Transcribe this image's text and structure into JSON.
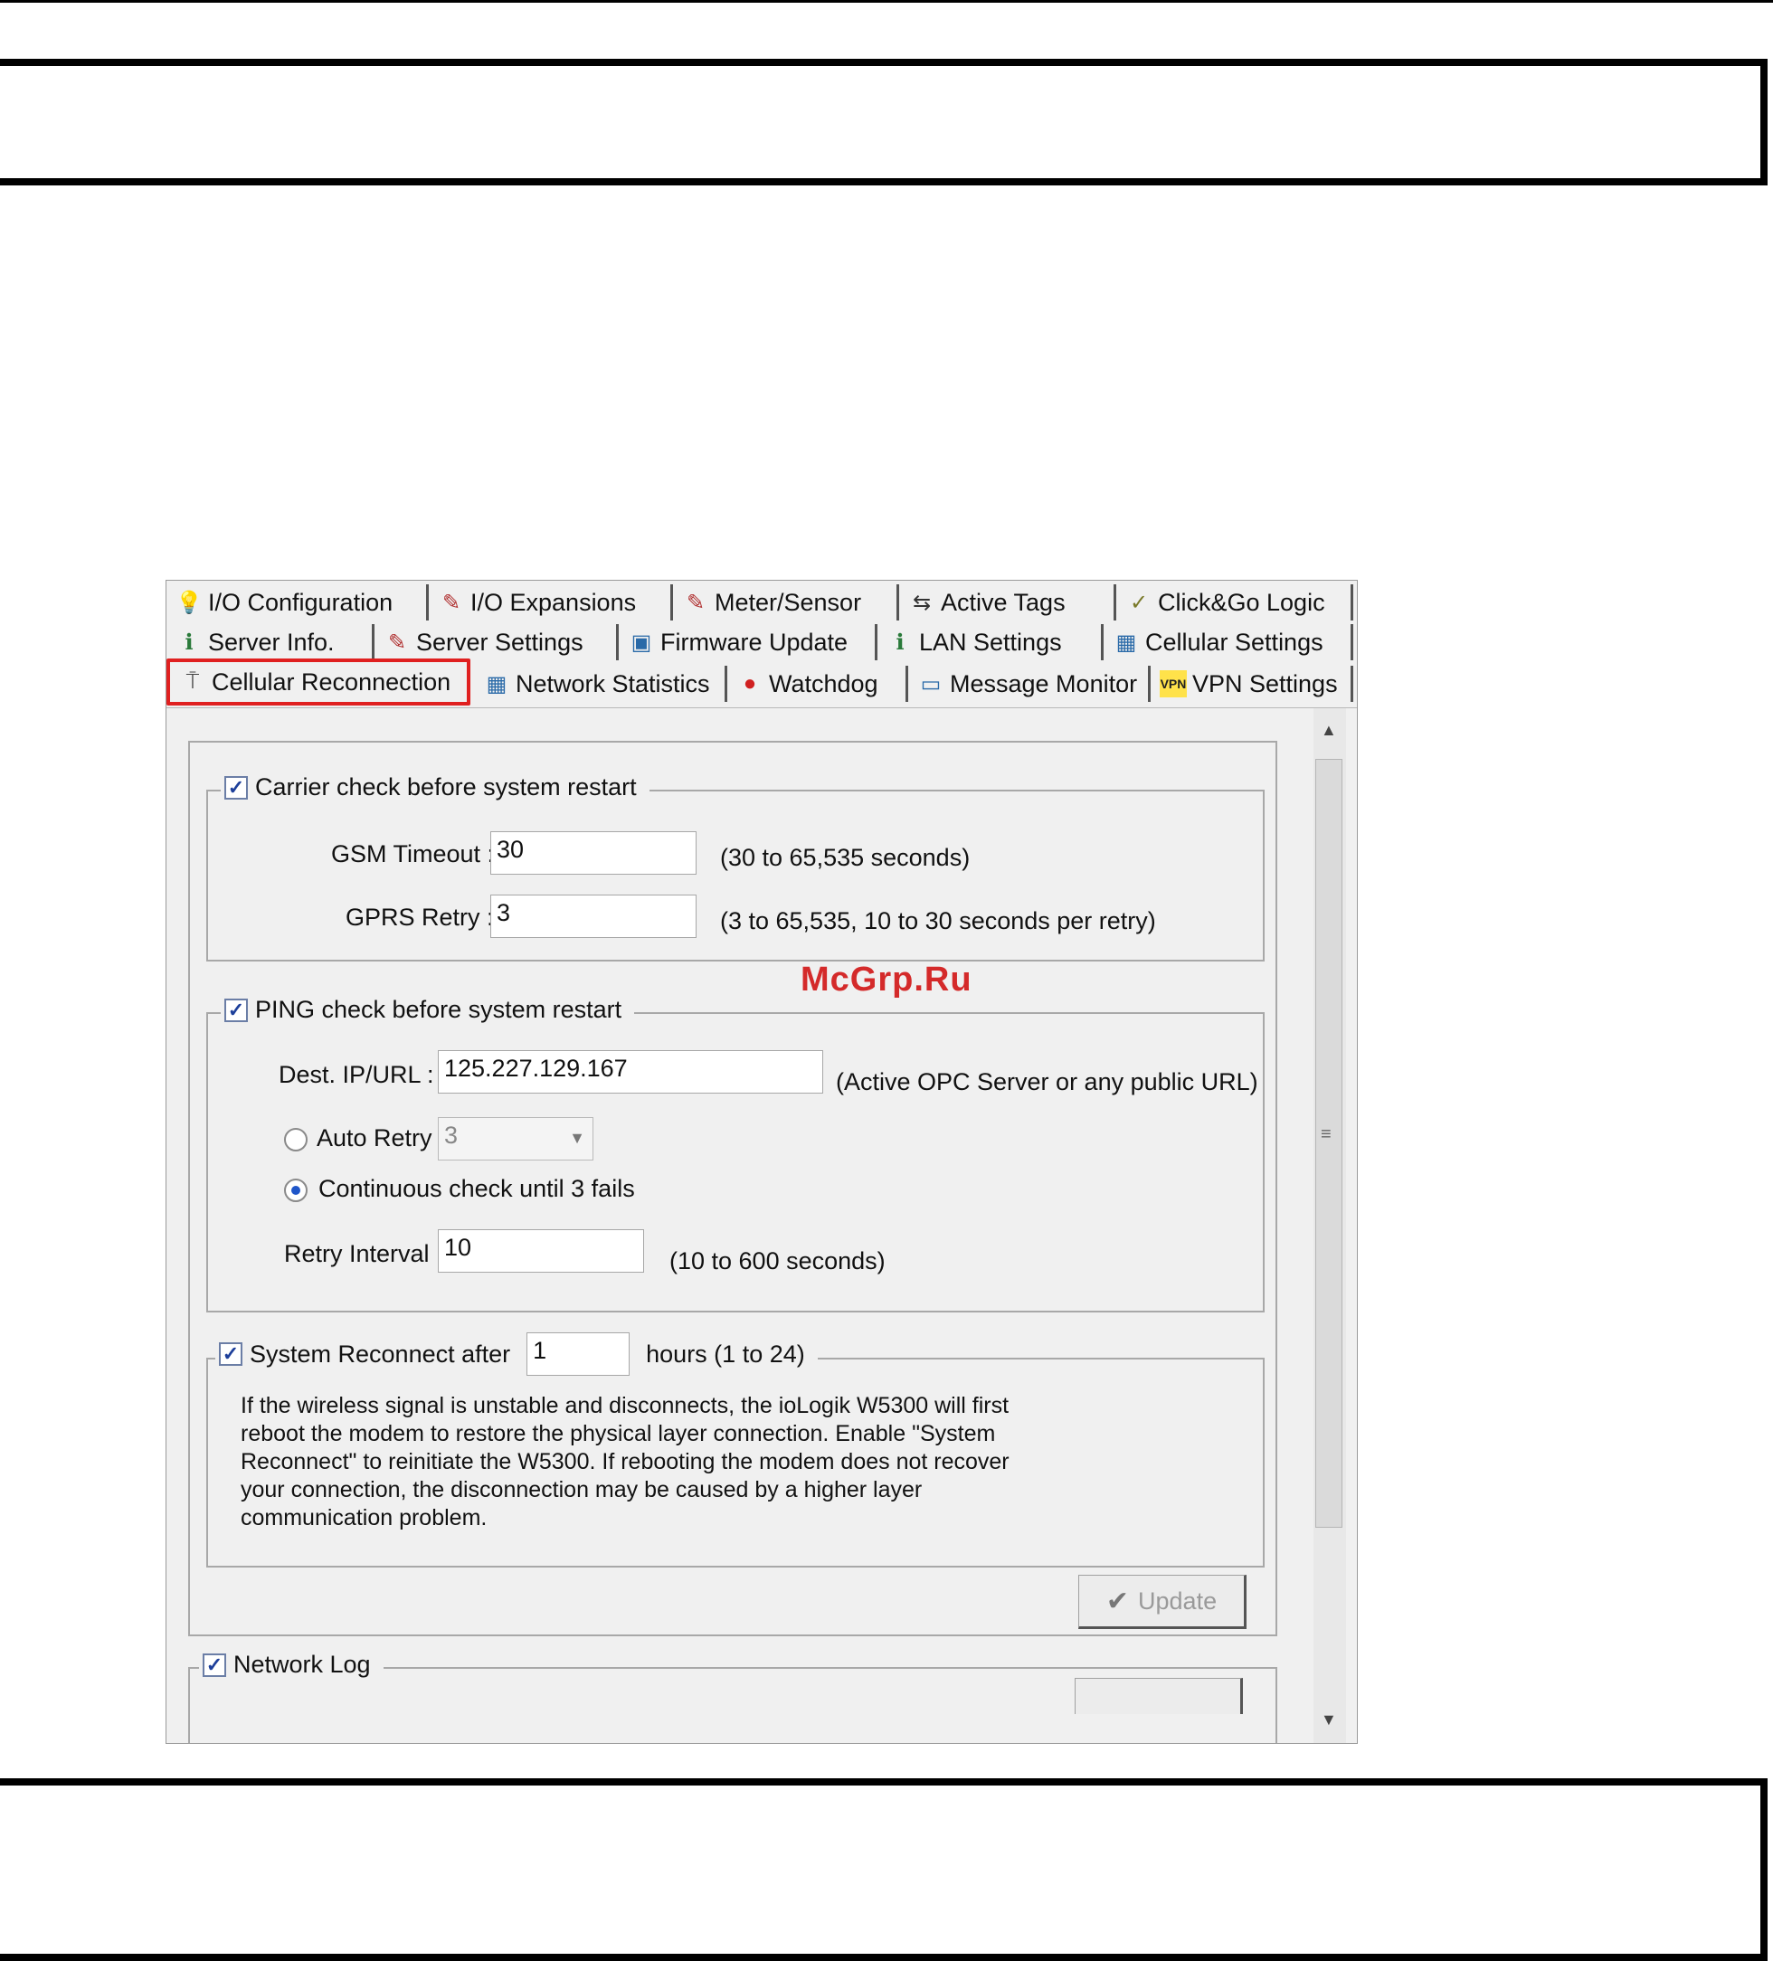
{
  "tabs": {
    "row1": [
      "I/O Configuration",
      "I/O Expansions",
      "Meter/Sensor",
      "Active Tags",
      "Click&Go Logic"
    ],
    "row2": [
      "Server Info.",
      "Server Settings",
      "Firmware Update",
      "LAN Settings",
      "Cellular Settings"
    ],
    "row3": [
      "Cellular Reconnection",
      "Network Statistics",
      "Watchdog",
      "Message Monitor",
      "VPN Settings"
    ],
    "active": "Cellular Reconnection"
  },
  "carrier": {
    "label": "Carrier check before system restart",
    "checked": true,
    "gsm_label": "GSM Timeout :",
    "gsm_value": "30",
    "gsm_hint": "(30 to 65,535 seconds)",
    "gprs_label": "GPRS Retry :",
    "gprs_value": "3",
    "gprs_hint": "(3 to 65,535, 10 to 30 seconds per retry)"
  },
  "ping": {
    "label": "PING check before system restart",
    "checked": true,
    "dest_label": "Dest. IP/URL :",
    "dest_value": "125.227.129.167",
    "dest_hint": "(Active OPC Server or any public URL)",
    "auto_retry_label": "Auto Retry",
    "auto_retry_value": "3",
    "continuous_label": "Continuous check until 3 fails",
    "interval_label": "Retry Interval :",
    "interval_value": "10",
    "interval_hint": "(10 to 600 seconds)"
  },
  "reconnect": {
    "label": "System Reconnect after",
    "checked": true,
    "hours_value": "1",
    "hours_hint": "hours (1 to 24)",
    "description": "If the wireless signal is unstable and disconnects, the ioLogik W5300 will first reboot the modem to restore the physical layer connection. Enable \"System Reconnect\" to reinitiate the W5300. If rebooting the modem does not recover your connection, the disconnection may be caused by a higher layer communication problem."
  },
  "update_button": "Update",
  "network_log": {
    "label": "Network Log",
    "checked": true
  },
  "watermark": "McGrp.Ru",
  "colors": {
    "highlight": "#e02020",
    "window_bg": "#f0f0f0",
    "watermark": "#d42a2a"
  }
}
